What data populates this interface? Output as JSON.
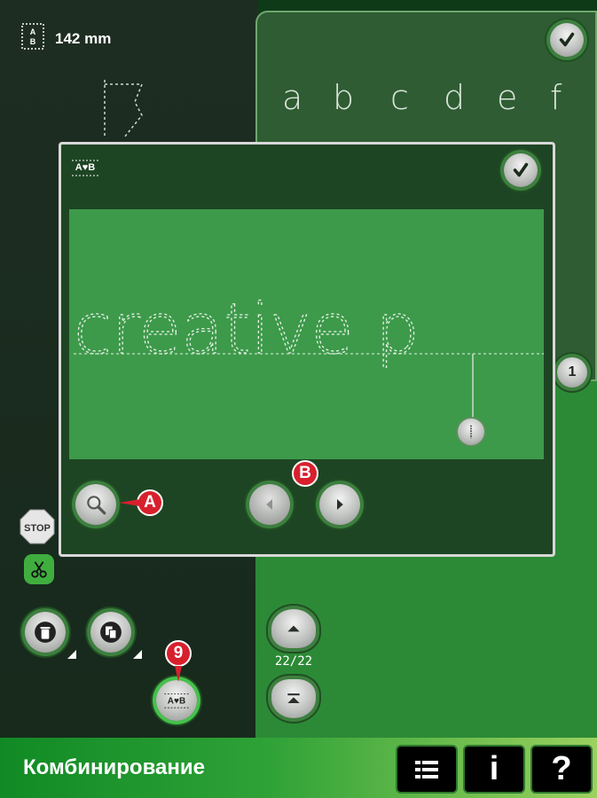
{
  "header": {
    "width_label": "142 mm"
  },
  "alphabet": {
    "letters": [
      "a",
      "b",
      "c",
      "d",
      "e",
      "f"
    ],
    "partial_button_label": "1"
  },
  "popup": {
    "text_preview": "creative p"
  },
  "callouts": {
    "a": "A",
    "b": "B",
    "nine": "9"
  },
  "left_controls": {
    "stop_label": "STOP"
  },
  "scroll": {
    "page_indicator": "22/22"
  },
  "bottom_bar": {
    "title": "Комбинирование",
    "info_label": "i",
    "help_label": "?"
  },
  "colors": {
    "accent_red": "#d8202d",
    "panel_green": "#3d9a4a",
    "bar_green": "#2fa237"
  }
}
